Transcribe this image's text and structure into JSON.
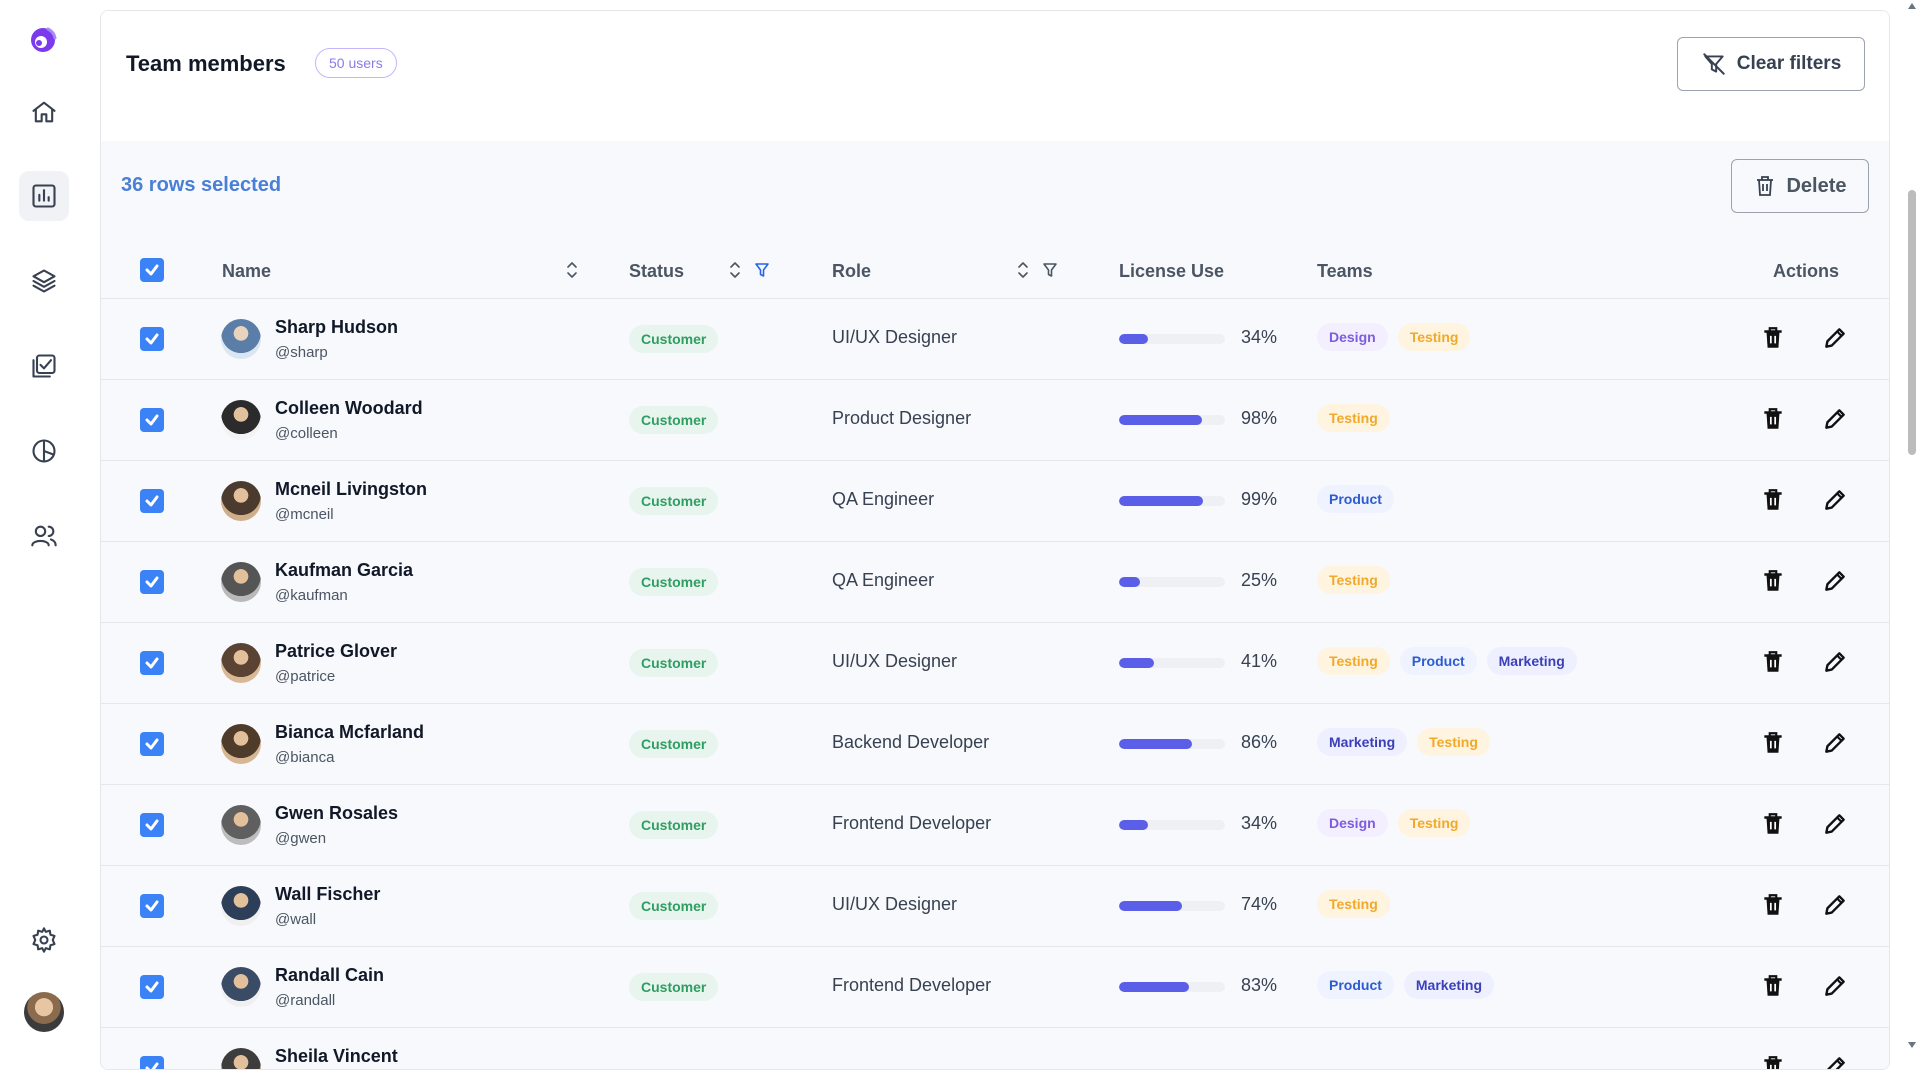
{
  "sidebar": {
    "items": [
      {
        "name": "home-icon"
      },
      {
        "name": "chart-icon"
      },
      {
        "name": "layers-icon"
      },
      {
        "name": "checklist-icon"
      },
      {
        "name": "pie-chart-icon"
      },
      {
        "name": "users-icon"
      }
    ],
    "settings": "gear-icon"
  },
  "header": {
    "title": "Team members",
    "count_badge": "50 users",
    "clear_filters": "Clear filters"
  },
  "selection": {
    "text": "36 rows selected",
    "delete_label": "Delete"
  },
  "table": {
    "columns": {
      "name": "Name",
      "status": "Status",
      "role": "Role",
      "license": "License Use",
      "teams": "Teams",
      "actions": "Actions"
    },
    "rows": [
      {
        "name": "Sharp Hudson",
        "handle": "@sharp",
        "status": "Customer",
        "role": "UI/UX Designer",
        "license": 34,
        "license_label": "34%",
        "teams": [
          "Design",
          "Testing"
        ]
      },
      {
        "name": "Colleen Woodard",
        "handle": "@colleen",
        "status": "Customer",
        "role": "Product Designer",
        "license": 98,
        "license_label": "98%",
        "teams": [
          "Testing"
        ]
      },
      {
        "name": "Mcneil Livingston",
        "handle": "@mcneil",
        "status": "Customer",
        "role": "QA Engineer",
        "license": 99,
        "license_label": "99%",
        "teams": [
          "Product"
        ]
      },
      {
        "name": "Kaufman Garcia",
        "handle": "@kaufman",
        "status": "Customer",
        "role": "QA Engineer",
        "license": 25,
        "license_label": "25%",
        "teams": [
          "Testing"
        ]
      },
      {
        "name": "Patrice Glover",
        "handle": "@patrice",
        "status": "Customer",
        "role": "UI/UX Designer",
        "license": 41,
        "license_label": "41%",
        "teams": [
          "Testing",
          "Product",
          "Marketing"
        ]
      },
      {
        "name": "Bianca Mcfarland",
        "handle": "@bianca",
        "status": "Customer",
        "role": "Backend Developer",
        "license": 86,
        "license_label": "86%",
        "teams": [
          "Marketing",
          "Testing"
        ]
      },
      {
        "name": "Gwen Rosales",
        "handle": "@gwen",
        "status": "Customer",
        "role": "Frontend Developer",
        "license": 34,
        "license_label": "34%",
        "teams": [
          "Design",
          "Testing"
        ]
      },
      {
        "name": "Wall Fischer",
        "handle": "@wall",
        "status": "Customer",
        "role": "UI/UX Designer",
        "license": 74,
        "license_label": "74%",
        "teams": [
          "Testing"
        ]
      },
      {
        "name": "Randall Cain",
        "handle": "@randall",
        "status": "Customer",
        "role": "Frontend Developer",
        "license": 83,
        "license_label": "83%",
        "teams": [
          "Product",
          "Marketing"
        ]
      },
      {
        "name": "Sheila Vincent",
        "handle": "",
        "status": "",
        "role": "",
        "license": 0,
        "license_label": "",
        "teams": []
      }
    ]
  },
  "colors": {
    "accent": "#3b82f6",
    "license_bar": "#5b5fe8",
    "status_bg": "#e8f5ee",
    "status_text": "#2f9e62"
  }
}
